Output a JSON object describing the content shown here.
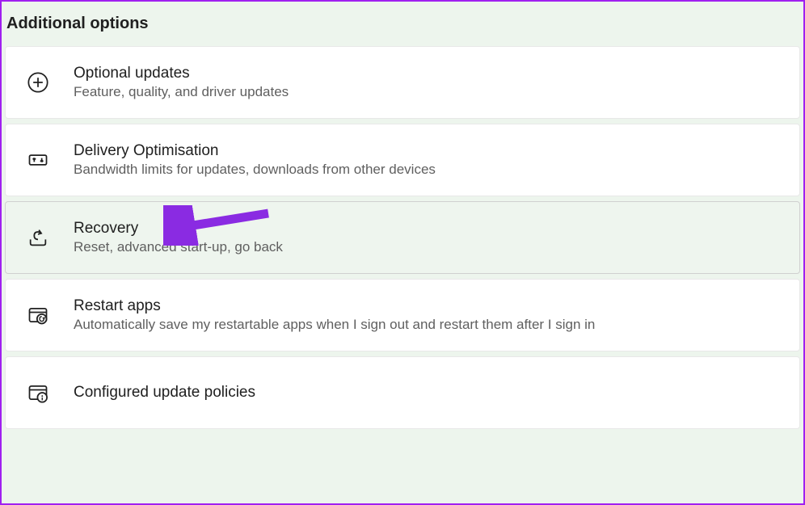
{
  "section": {
    "title": "Additional options"
  },
  "options": [
    {
      "title": "Optional updates",
      "desc": "Feature, quality, and driver updates",
      "icon": "plus-circle"
    },
    {
      "title": "Delivery Optimisation",
      "desc": "Bandwidth limits for updates, downloads from other devices",
      "icon": "delivery"
    },
    {
      "title": "Recovery",
      "desc": "Reset, advanced start-up, go back",
      "icon": "recovery",
      "highlighted": true
    },
    {
      "title": "Restart apps",
      "desc": "Automatically save my restartable apps when I sign out and restart them after I sign in",
      "icon": "restart-apps"
    },
    {
      "title": "Configured update policies",
      "desc": "",
      "icon": "update-policies"
    }
  ],
  "annotation": {
    "arrow_color": "#8a2be2",
    "target": "Recovery"
  }
}
